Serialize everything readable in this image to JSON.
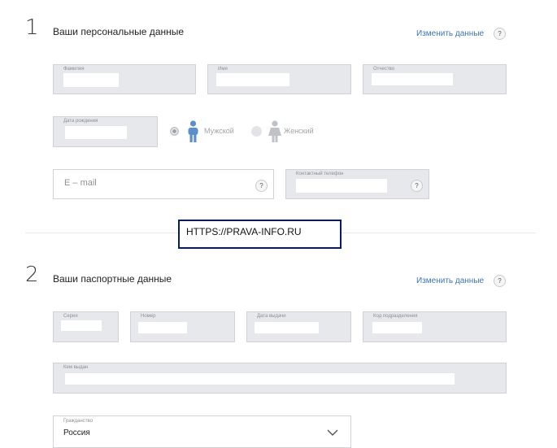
{
  "section1": {
    "number": "1",
    "title": "Ваши персональные данные",
    "edit_link": "Изменить данные",
    "help": "?",
    "fields": {
      "surname_label": "Фамилия",
      "name_label": "Имя",
      "patronymic_label": "Отчество",
      "birthdate_label": "Дата рождения",
      "phone_label": "Контактный телефон"
    },
    "gender": {
      "male": "Мужской",
      "female": "Женский",
      "selected": "Мужской"
    },
    "email": {
      "placeholder": "E – mail"
    }
  },
  "watermark": "HTTPS://PRAVA-INFO.RU",
  "section2": {
    "number": "2",
    "title": "Ваши паспортные данные",
    "edit_link": "Изменить данные",
    "help": "?",
    "fields": {
      "series_label": "Серия",
      "number_label": "Номер",
      "issue_date_label": "Дата выдачи",
      "division_code_label": "Код подразделения",
      "issued_by_label": "Кем выдан"
    },
    "citizenship": {
      "label": "Гражданство",
      "value": "Россия"
    }
  },
  "colors": {
    "accent": "#3f73b0",
    "field_bg": "#e6e8eb",
    "male_icon": "#5b8fc9",
    "female_icon": "#bfc3c8",
    "watermark_border": "#0b1b5a"
  }
}
